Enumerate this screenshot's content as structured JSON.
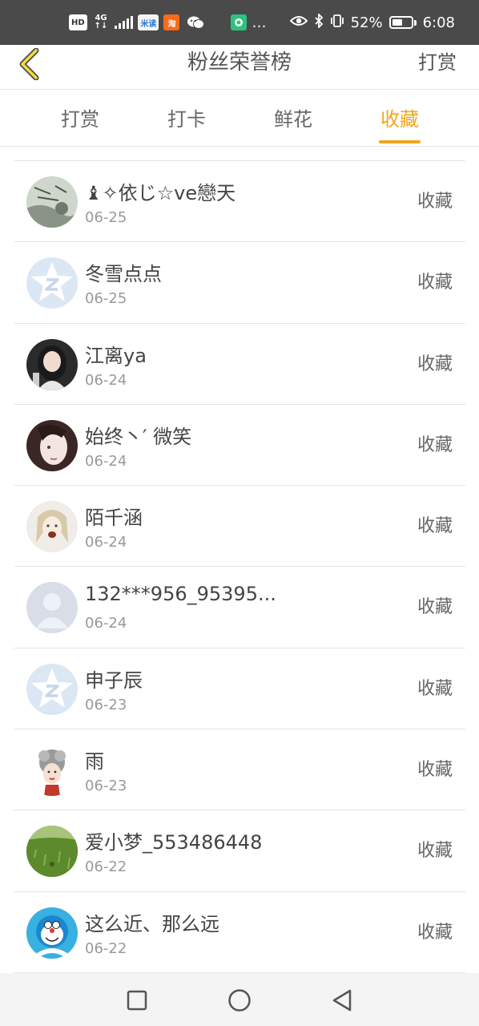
{
  "status_bar": {
    "left_labels": [
      "HD",
      "4G",
      "米读",
      "淘",
      "…"
    ],
    "battery": "52%",
    "time": "6:08",
    "icons": [
      "hd-icon",
      "signal-icon",
      "app-icon",
      "taobao-icon",
      "wechat-icon",
      "game-icon",
      "eye-icon",
      "bluetooth-icon",
      "vibrate-icon",
      "battery-icon"
    ]
  },
  "header": {
    "title": "粉丝荣誉榜",
    "action": "打赏",
    "back_icon": "chevron-left-icon",
    "accent_color": "#f0a51d"
  },
  "tabs": [
    {
      "label": "打赏",
      "active": false
    },
    {
      "label": "打卡",
      "active": false
    },
    {
      "label": "鲜花",
      "active": false
    },
    {
      "label": "收藏",
      "active": true
    }
  ],
  "list": [
    {
      "name": "♝✧依じ☆ve戀天",
      "date": "06-25",
      "action": "收藏",
      "avatar": "photo-avatar"
    },
    {
      "name": "冬雪点点",
      "date": "06-25",
      "action": "收藏",
      "avatar": "qq-default-avatar"
    },
    {
      "name": "江离ya",
      "date": "06-24",
      "action": "收藏",
      "avatar": "photo-avatar"
    },
    {
      "name": "始终丶′ 微笑",
      "date": "06-24",
      "action": "收藏",
      "avatar": "photo-avatar"
    },
    {
      "name": "陌千涵",
      "date": "06-24",
      "action": "收藏",
      "avatar": "photo-avatar"
    },
    {
      "name": "132***956_95395...",
      "date": "06-24",
      "action": "收藏",
      "avatar": "default-user-avatar"
    },
    {
      "name": "申子辰",
      "date": "06-23",
      "action": "收藏",
      "avatar": "qq-default-avatar"
    },
    {
      "name": "雨",
      "date": "06-23",
      "action": "收藏",
      "avatar": "photo-avatar"
    },
    {
      "name": "爱小梦_553486448",
      "date": "06-22",
      "action": "收藏",
      "avatar": "photo-avatar"
    },
    {
      "name": "这么近、那么远",
      "date": "06-22",
      "action": "收藏",
      "avatar": "photo-avatar"
    }
  ],
  "navbar": {
    "icons": [
      "recent-apps-icon",
      "home-icon",
      "back-icon"
    ]
  }
}
